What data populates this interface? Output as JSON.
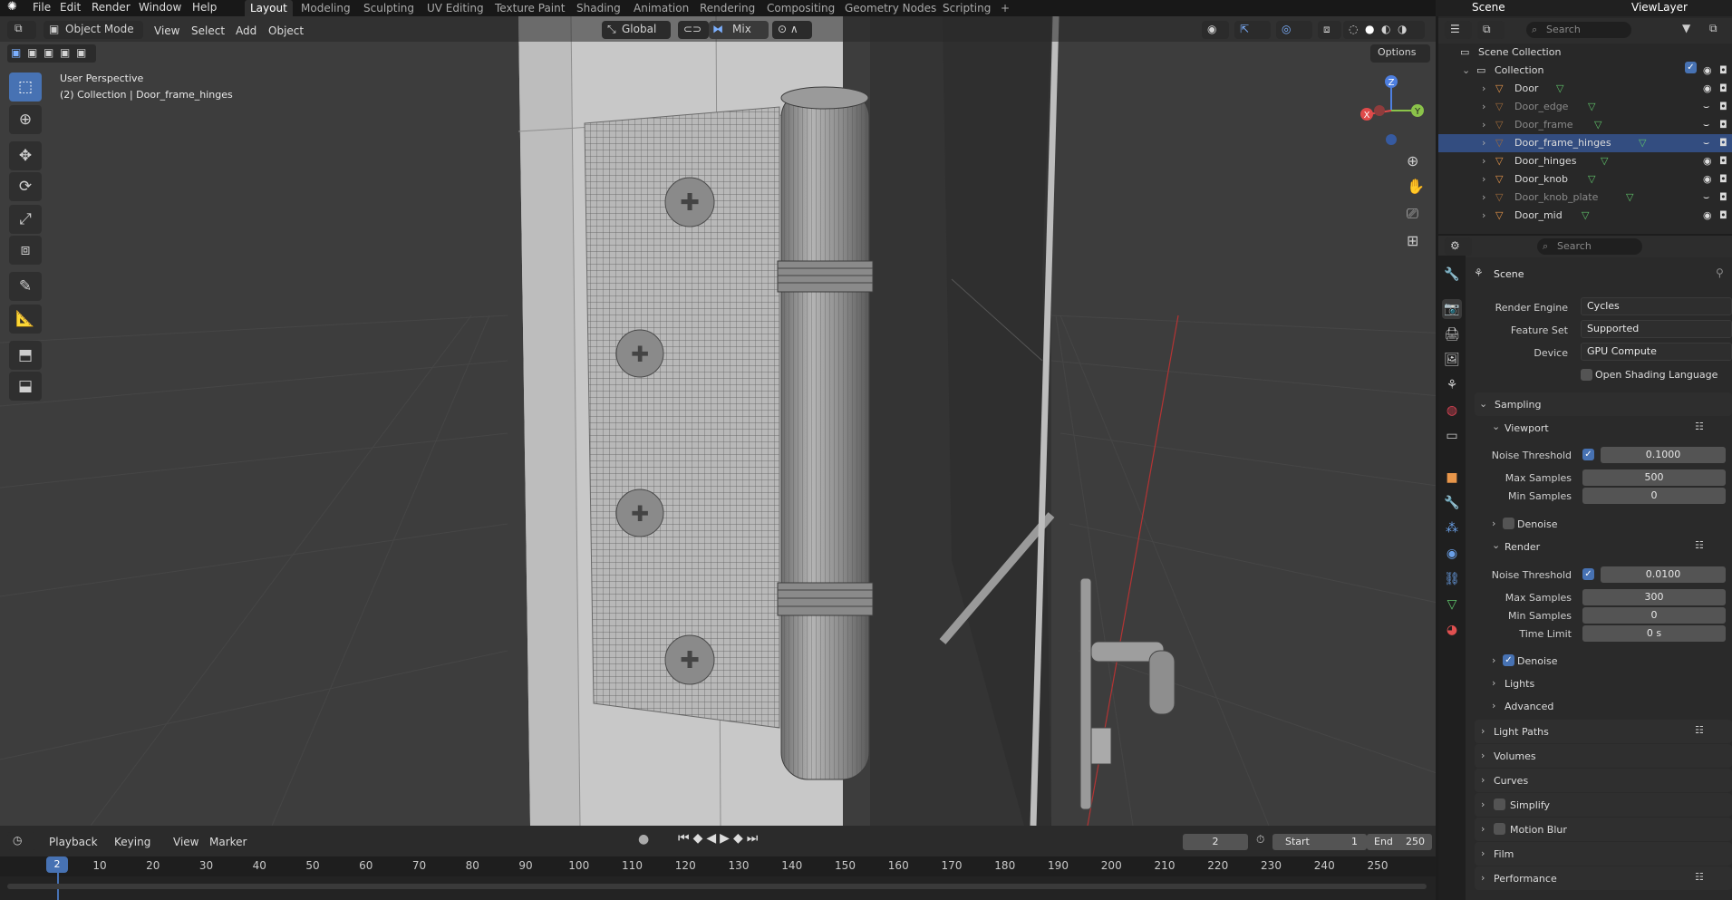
{
  "menubar": {
    "items": [
      "File",
      "Edit",
      "Render",
      "Window",
      "Help"
    ],
    "workspaces": [
      "Layout",
      "Modeling",
      "Sculpting",
      "UV Editing",
      "Texture Paint",
      "Shading",
      "Animation",
      "Rendering",
      "Compositing",
      "Geometry Nodes",
      "Scripting"
    ],
    "scene": "Scene",
    "view_layer": "ViewLayer"
  },
  "viewport_header": {
    "mode": "Object Mode",
    "menus": [
      "View",
      "Select",
      "Add",
      "Object"
    ],
    "transform_orientation": "Global",
    "snap_mix": "Mix",
    "options": "Options"
  },
  "viewport_overlay": {
    "perspective": "User Perspective",
    "collection_info": "(2) Collection | Door_frame_hinges"
  },
  "gizmo": {
    "x": "X",
    "y": "Y",
    "z": "Z"
  },
  "outliner": {
    "search_placeholder": "Search",
    "root": "Scene Collection",
    "collection": "Collection",
    "objects": [
      {
        "name": "Door",
        "state": "visible"
      },
      {
        "name": "Door_edge",
        "state": "hidden"
      },
      {
        "name": "Door_frame",
        "state": "hidden"
      },
      {
        "name": "Door_frame_hinges",
        "state": "selected"
      },
      {
        "name": "Door_hinges",
        "state": "visible"
      },
      {
        "name": "Door_knob",
        "state": "visible"
      },
      {
        "name": "Door_knob_plate",
        "state": "hidden"
      },
      {
        "name": "Door_mid",
        "state": "visible"
      }
    ]
  },
  "properties": {
    "search_placeholder": "Search",
    "context": "Scene",
    "render_engine_label": "Render Engine",
    "render_engine": "Cycles",
    "feature_set_label": "Feature Set",
    "feature_set": "Supported",
    "device_label": "Device",
    "device": "GPU Compute",
    "osl_label": "Open Shading Language",
    "sampling": "Sampling",
    "viewport": "Viewport",
    "vp_noise_label": "Noise Threshold",
    "vp_noise": "0.1000",
    "vp_max_label": "Max Samples",
    "vp_max": "500",
    "vp_min_label": "Min Samples",
    "vp_min": "0",
    "denoise_label": "Denoise",
    "render": "Render",
    "r_noise_label": "Noise Threshold",
    "r_noise": "0.0100",
    "r_max_label": "Max Samples",
    "r_max": "300",
    "r_min_label": "Min Samples",
    "r_min": "0",
    "time_limit_label": "Time Limit",
    "time_limit": "0 s",
    "r_denoise_label": "Denoise",
    "lights": "Lights",
    "advanced": "Advanced",
    "panels": [
      "Light Paths",
      "Volumes",
      "Curves",
      "Simplify",
      "Motion Blur",
      "Film",
      "Performance"
    ]
  },
  "timeline": {
    "menus": [
      "Playback",
      "Keying",
      "View",
      "Marker"
    ],
    "current_frame": "2",
    "start_label": "Start",
    "start": "1",
    "end_label": "End",
    "end": "250",
    "playhead": "2",
    "ticks": [
      "10",
      "20",
      "30",
      "40",
      "50",
      "60",
      "70",
      "80",
      "90",
      "100",
      "110",
      "120",
      "130",
      "140",
      "150",
      "160",
      "170",
      "180",
      "190",
      "200",
      "210",
      "220",
      "230",
      "240",
      "250"
    ]
  },
  "colors": {
    "accent": "#4772b3",
    "selected_row": "#334d80",
    "object_orange": "#e8964a",
    "mesh_green": "#5fc26a"
  }
}
